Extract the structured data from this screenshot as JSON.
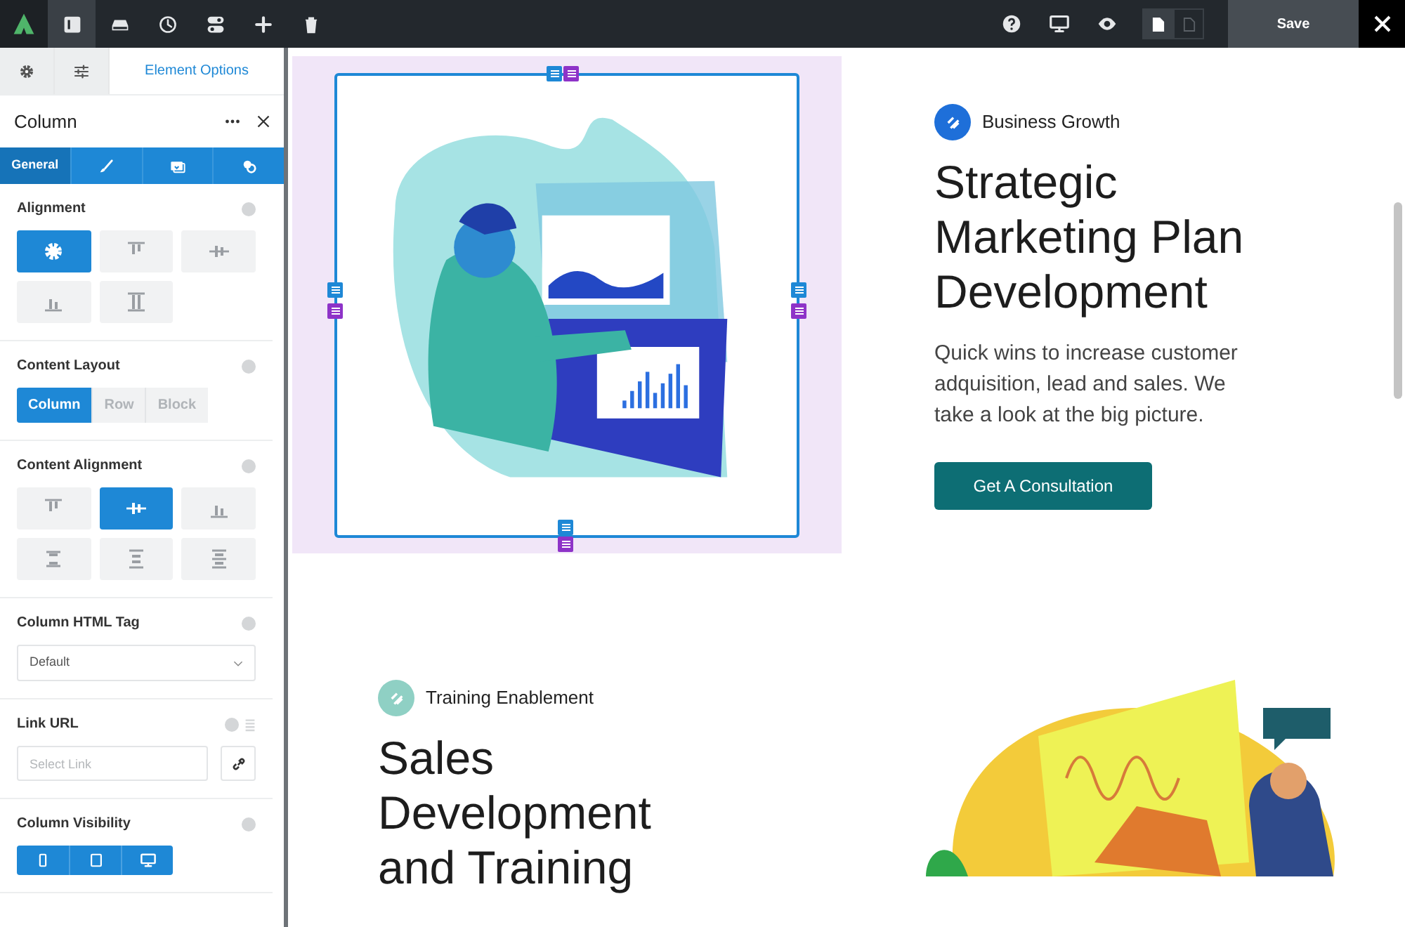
{
  "toolbar": {
    "tools": [
      {
        "kind": "layout",
        "selected": true
      },
      {
        "kind": "library",
        "selected": false
      },
      {
        "kind": "history",
        "selected": false
      },
      {
        "kind": "toggles",
        "selected": false
      },
      {
        "kind": "add",
        "selected": false
      },
      {
        "kind": "delete",
        "selected": false
      }
    ],
    "actions": [
      {
        "kind": "help"
      },
      {
        "kind": "desktop"
      },
      {
        "kind": "preview"
      }
    ],
    "view_modes": [
      {
        "selected": true
      },
      {
        "selected": false
      }
    ],
    "save": "Save"
  },
  "panel": {
    "tabs": [
      {
        "kind": "settings",
        "selected": false
      },
      {
        "kind": "sliders",
        "selected": false
      },
      {
        "kind": "text",
        "label": "Element Options",
        "selected": true
      }
    ],
    "title": "Column",
    "subtabs": [
      {
        "kind": "text",
        "label": "General",
        "selected": true
      },
      {
        "kind": "brush",
        "selected": false
      },
      {
        "kind": "media",
        "selected": false
      },
      {
        "kind": "extras",
        "selected": false
      }
    ],
    "sections": [
      {
        "kind": "icons",
        "label": "Alignment",
        "options": [
          {
            "kind": "gear",
            "selected": true
          },
          {
            "kind": "top",
            "selected": false
          },
          {
            "kind": "middle",
            "selected": false
          },
          {
            "kind": "bottom",
            "selected": false
          },
          {
            "kind": "stretch",
            "selected": false
          }
        ]
      },
      {
        "kind": "segments",
        "label": "Content Layout",
        "options": [
          {
            "label": "Column",
            "selected": true
          },
          {
            "label": "Row",
            "selected": false
          },
          {
            "label": "Block",
            "selected": false
          }
        ]
      },
      {
        "kind": "icons",
        "label": "Content Alignment",
        "options": [
          {
            "kind": "top",
            "selected": false
          },
          {
            "kind": "middle",
            "selected": true
          },
          {
            "kind": "bottom",
            "selected": false
          },
          {
            "kind": "between",
            "selected": false
          },
          {
            "kind": "around",
            "selected": false
          },
          {
            "kind": "evenly",
            "selected": false
          }
        ]
      },
      {
        "kind": "select",
        "label": "Column HTML Tag",
        "value": "Default"
      },
      {
        "kind": "link",
        "label": "Link URL",
        "placeholder": "Select Link"
      },
      {
        "kind": "devices",
        "label": "Column Visibility",
        "options": [
          {
            "kind": "mobile",
            "on": true
          },
          {
            "kind": "tablet",
            "on": true
          },
          {
            "kind": "desktop",
            "on": true
          }
        ]
      }
    ]
  },
  "canvas": {
    "sections": [
      {
        "badge": "Business Growth",
        "title_lines": [
          "Strategic",
          "Marketing Plan",
          "Development"
        ],
        "text": "Quick wins to increase customer adquisition, lead and sales. We take a look at the big picture.",
        "button": "Get A Consultation"
      },
      {
        "badge": "Training Enablement",
        "title_lines": [
          "Sales",
          "Development",
          "and Training"
        ]
      }
    ]
  }
}
